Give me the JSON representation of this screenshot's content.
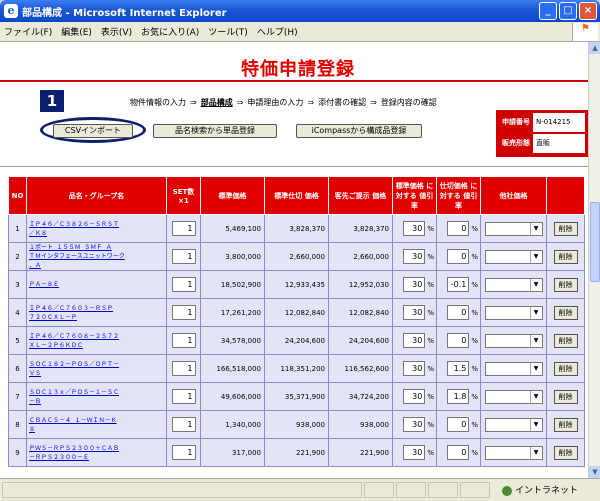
{
  "window": {
    "title": "部品構成 - Microsoft Internet Explorer",
    "minimize": "_",
    "maximize": "□",
    "close": "×"
  },
  "menu": [
    "ファイル(F)",
    "編集(E)",
    "表示(V)",
    "お気に入り(A)",
    "ツール(T)",
    "ヘルプ(H)"
  ],
  "page": {
    "title": "特価申請登録",
    "step_number": "1",
    "steps": [
      "物件情報の入力",
      "部品構成",
      "申請理由の入力",
      "添付書の確認",
      "登録内容の確認"
    ],
    "arrow": "⇒",
    "current_step_index": 1,
    "buttons": {
      "csv_import": "CSVインポート",
      "product_search": "品名検索から単品登録",
      "icompass": "iCompassから構成品登録"
    },
    "info": {
      "app_no_label": "申請番号",
      "app_no_value": "N-014215",
      "sales_form_label": "販売形態",
      "sales_form_value": "直販"
    }
  },
  "table": {
    "headers": [
      "NO",
      "品名・グループ名",
      "SET数 ×1",
      "標準価格",
      "標準仕切 価格",
      "客先ご提示 価格",
      "標準価格 に対する 値引率",
      "仕切価格 に対する 値引率",
      "他社価格",
      ""
    ],
    "pct_unit": "%",
    "delete_label": "削除",
    "rows": [
      {
        "no": "1",
        "name": [
          "ＩＰ４６／Ｃ３８２６－ＳＲＳＴ",
          "／Ｋ８"
        ],
        "qty": "1",
        "std": "5,469,100",
        "std_div": "3,828,370",
        "client": "3,828,370",
        "rate1": "30",
        "rate2": "0",
        "rate2_suffix": "%"
      },
      {
        "no": "2",
        "name": [
          "１ポート １５５Ｍ ＳＭＦ Ａ",
          "ＴＭインタフェースユニットワーク",
          "．Ａ"
        ],
        "qty": "1",
        "std": "3,800,000",
        "std_div": "2,660,000",
        "client": "2,660,000",
        "rate1": "30",
        "rate2": "0",
        "rate2_suffix": "%"
      },
      {
        "no": "3",
        "name": [
          "ＰＡ－８Ｅ"
        ],
        "qty": "1",
        "std": "18,502,900",
        "std_div": "12,933,435",
        "client": "12,952,030",
        "rate1": "30",
        "rate2": "-0.1",
        "rate2_suffix": "%"
      },
      {
        "no": "4",
        "name": [
          "ＩＰ４６／Ｃ７６０３－ＲＳＰ",
          "７２０ＣＸＬ－Ｐ"
        ],
        "qty": "1",
        "std": "17,261,200",
        "std_div": "12,082,840",
        "client": "12,082,840",
        "rate1": "30",
        "rate2": "0",
        "rate2_suffix": "%"
      },
      {
        "no": "5",
        "name": [
          "ＩＰ４６／Ｃ７６０８－２Ｓ７２",
          "ＸＬ－２Ｐ６ＫＤＣ"
        ],
        "qty": "1",
        "std": "34,578,000",
        "std_div": "24,204,600",
        "client": "24,204,600",
        "rate1": "30",
        "rate2": "0",
        "rate2_suffix": "%"
      },
      {
        "no": "6",
        "name": [
          "ＳＯＣ１８２－ＰＯＳ／ＯＰＴ－",
          "ＶＳ"
        ],
        "qty": "1",
        "std": "166,518,000",
        "std_div": "118,351,200",
        "client": "116,562,600",
        "rate1": "30",
        "rate2": "1.5",
        "rate2_suffix": "%"
      },
      {
        "no": "7",
        "name": [
          "ＳＯＣ１３ｘ／ＰＯＳ－１－ＳＣ",
          "－Ｂ"
        ],
        "qty": "1",
        "std": "49,606,000",
        "std_div": "35,371,900",
        "client": "34,724,200",
        "rate1": "30",
        "rate2": "1.8",
        "rate2_suffix": "%"
      },
      {
        "no": "8",
        "name": [
          "ＣＢＡＣＳ－４ １－ＷＩＮ－Ｋ",
          "８"
        ],
        "qty": "1",
        "std": "1,340,000",
        "std_div": "938,000",
        "client": "938,000",
        "rate1": "30",
        "rate2": "0",
        "rate2_suffix": "%"
      },
      {
        "no": "9",
        "name": [
          "ＰＷＳ－ＲＰＳ２３００＋ＣＡＢ",
          "－ＲＰＳ２３００－Ｅ"
        ],
        "qty": "1",
        "std": "317,000",
        "std_div": "221,900",
        "client": "221,900",
        "rate1": "30",
        "rate2": "0",
        "rate2_suffix": "%"
      }
    ]
  },
  "status": {
    "zone": "イントラネット"
  }
}
